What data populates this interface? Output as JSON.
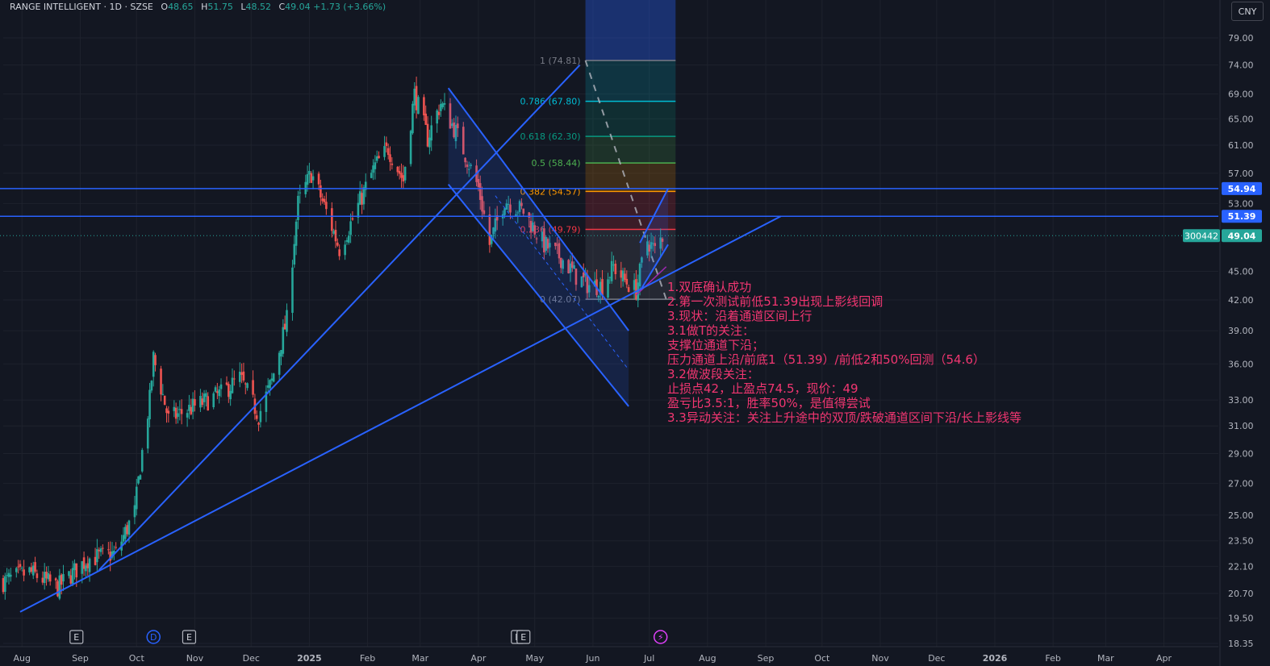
{
  "header": {
    "symbol": "RANGE INTELLIGENT · 1D · SZSE",
    "open_label": "O",
    "open": "48.65",
    "high_label": "H",
    "high": "51.75",
    "low_label": "L",
    "low": "48.52",
    "close_label": "C",
    "close": "49.04",
    "change": "+1.73 (+3.66%)"
  },
  "currency": "CNY",
  "notes": [
    "1.双底确认成功",
    "2.第一次测试前低51.39出现上影线回调",
    "3.现状：沿着通道区间上行",
    "3.1做T的关注：",
    "支撑位通道下沿；",
    "压力通道上沿/前底1（51.39）/前低2和50%回测（54.6）",
    "3.2做波段关注：",
    "止损点42，止盈点74.5，现价：49",
    "盈亏比3.5:1，胜率50%，是值得尝试",
    "3.3异动关注：关注上升途中的双顶/跌破通道区间下沿/长上影线等"
  ],
  "colors": {
    "background": "#131722",
    "up": "#26a69a",
    "down": "#ef5350",
    "drawing": "#2962ff",
    "note": "#f23671"
  },
  "chart_data": {
    "type": "candlestick",
    "y_scale": "log",
    "ylim": [
      18.35,
      79.0
    ],
    "y_ticks": [
      "79.00",
      "74.00",
      "69.00",
      "65.00",
      "61.00",
      "57.00",
      "53.00",
      "45.00",
      "42.00",
      "39.00",
      "36.00",
      "33.00",
      "31.00",
      "29.00",
      "27.00",
      "25.00",
      "23.50",
      "22.10",
      "20.70",
      "19.50",
      "18.35"
    ],
    "x_ticks": [
      "Aug",
      "Sep",
      "Oct",
      "Nov",
      "Dec",
      "2025",
      "Feb",
      "Mar",
      "Apr",
      "May",
      "Jun",
      "Jul",
      "Aug",
      "Sep",
      "Oct",
      "Nov",
      "Dec",
      "2026",
      "Feb",
      "Mar",
      "Apr"
    ],
    "x_range": [
      "2024-07-22",
      "2026-04-30"
    ],
    "last_date": "2025-07-08",
    "price_path": [
      [
        "2024-07-22",
        21.3
      ],
      [
        "2024-08-05",
        21.8
      ],
      [
        "2024-08-20",
        21.0
      ],
      [
        "2024-09-05",
        22.5
      ],
      [
        "2024-09-20",
        22.8
      ],
      [
        "2024-09-30",
        25.2
      ],
      [
        "2024-10-08",
        33.0
      ],
      [
        "2024-10-10",
        36.5
      ],
      [
        "2024-10-18",
        31.5
      ],
      [
        "2024-11-01",
        32.5
      ],
      [
        "2024-11-15",
        33.5
      ],
      [
        "2024-11-25",
        34.8
      ],
      [
        "2024-12-05",
        31.8
      ],
      [
        "2024-12-12",
        34.5
      ],
      [
        "2024-12-20",
        40.0
      ],
      [
        "2024-12-26",
        53.0
      ],
      [
        "2025-01-02",
        57.0
      ],
      [
        "2025-01-10",
        52.0
      ],
      [
        "2025-01-17",
        47.5
      ],
      [
        "2025-01-24",
        51.0
      ],
      [
        "2025-02-05",
        58.0
      ],
      [
        "2025-02-12",
        60.5
      ],
      [
        "2025-02-20",
        56.0
      ],
      [
        "2025-02-26",
        69.0
      ],
      [
        "2025-03-05",
        62.0
      ],
      [
        "2025-03-12",
        67.5
      ],
      [
        "2025-03-20",
        63.0
      ],
      [
        "2025-04-01",
        55.0
      ],
      [
        "2025-04-07",
        48.0
      ],
      [
        "2025-04-15",
        53.5
      ],
      [
        "2025-04-25",
        52.0
      ],
      [
        "2025-05-06",
        48.0
      ],
      [
        "2025-05-15",
        46.5
      ],
      [
        "2025-05-23",
        44.5
      ],
      [
        "2025-05-30",
        43.5
      ],
      [
        "2025-06-06",
        43.5
      ],
      [
        "2025-06-12",
        45.5
      ],
      [
        "2025-06-18",
        44.0
      ],
      [
        "2025-06-24",
        43.0
      ],
      [
        "2025-06-30",
        48.5
      ],
      [
        "2025-07-04",
        47.3
      ],
      [
        "2025-07-08",
        49.04
      ]
    ],
    "horizontal_lines": [
      {
        "value": 54.94,
        "label": "54.94"
      },
      {
        "value": 51.39,
        "label": "51.39"
      }
    ],
    "current_price": {
      "value": 49.04,
      "label": "49.04",
      "tag": "300442"
    },
    "fib_levels": [
      {
        "ratio": "1",
        "value": 74.81,
        "label": "1 (74.81)",
        "color": "#787b86"
      },
      {
        "ratio": "0.786",
        "value": 67.8,
        "label": "0.786 (67.80)",
        "color": "#00bcd4"
      },
      {
        "ratio": "0.618",
        "value": 62.3,
        "label": "0.618 (62.30)",
        "color": "#089981"
      },
      {
        "ratio": "0.5",
        "value": 58.44,
        "label": "0.5 (58.44)",
        "color": "#4caf50"
      },
      {
        "ratio": "0.382",
        "value": 54.57,
        "label": "0.382 (54.57)",
        "color": "#ff9800"
      },
      {
        "ratio": "0.236",
        "value": 49.79,
        "label": "0.236 (49.79)",
        "color": "#f23645"
      },
      {
        "ratio": "0",
        "value": 42.07,
        "label": "0 (42.07)",
        "color": "#787b86"
      }
    ],
    "event_markers": [
      {
        "date": "2024-08-30",
        "label": "E"
      },
      {
        "date": "2024-10-10",
        "label": "D"
      },
      {
        "date": "2024-10-29",
        "label": "E"
      },
      {
        "date": "2025-04-22",
        "label": "E"
      },
      {
        "date": "2025-04-25",
        "label": "E"
      },
      {
        "date": "2025-07-07",
        "label": "⚡"
      }
    ]
  }
}
